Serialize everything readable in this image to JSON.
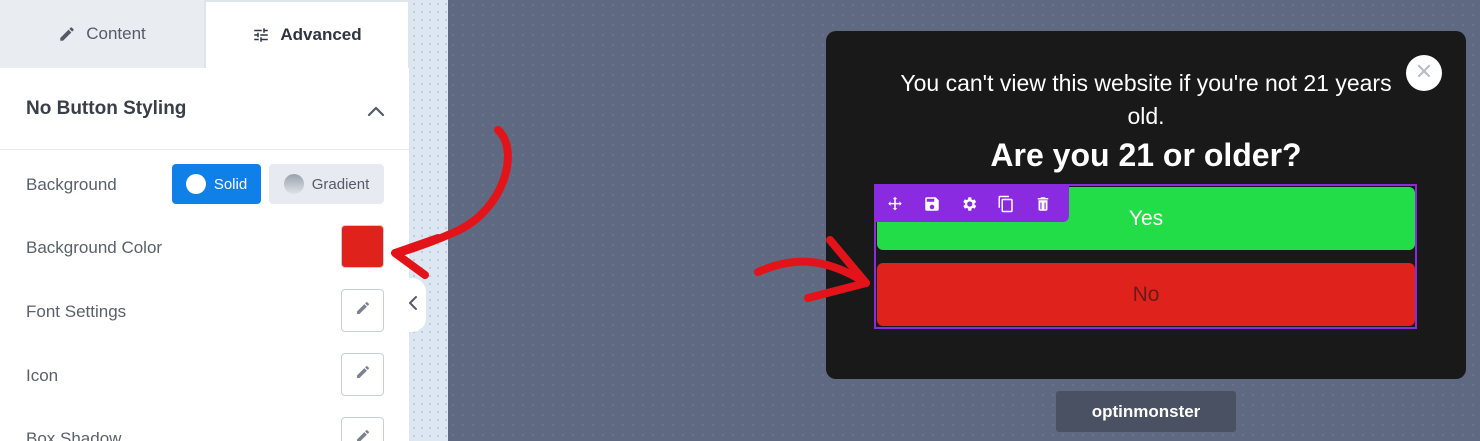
{
  "tabs": {
    "content_label": "Content",
    "advanced_label": "Advanced",
    "active": "Advanced"
  },
  "section": {
    "title": "No Button Styling",
    "expanded": true
  },
  "settings": {
    "background_label": "Background",
    "solid_label": "Solid",
    "gradient_label": "Gradient",
    "selected_background_type": "Solid",
    "background_color_label": "Background Color",
    "background_color_value": "#e0221d",
    "font_settings_label": "Font Settings",
    "icon_label": "Icon",
    "box_shadow_label": "Box Shadow"
  },
  "popup": {
    "message": "You can't view this website if you're not 21 years old.",
    "question": "Are you 21 or older?",
    "yes_label": "Yes",
    "no_label": "No",
    "toolbar_icons": [
      "move-icon",
      "save-icon",
      "gear-icon",
      "duplicate-icon",
      "trash-icon"
    ]
  },
  "brand": {
    "logo_text": "optinmonster"
  },
  "colors": {
    "accent": "#0f80e8",
    "selection": "#8a2be2",
    "yes": "#22dc48",
    "no": "#e0221d",
    "annotation_arrow": "#e3131a"
  }
}
